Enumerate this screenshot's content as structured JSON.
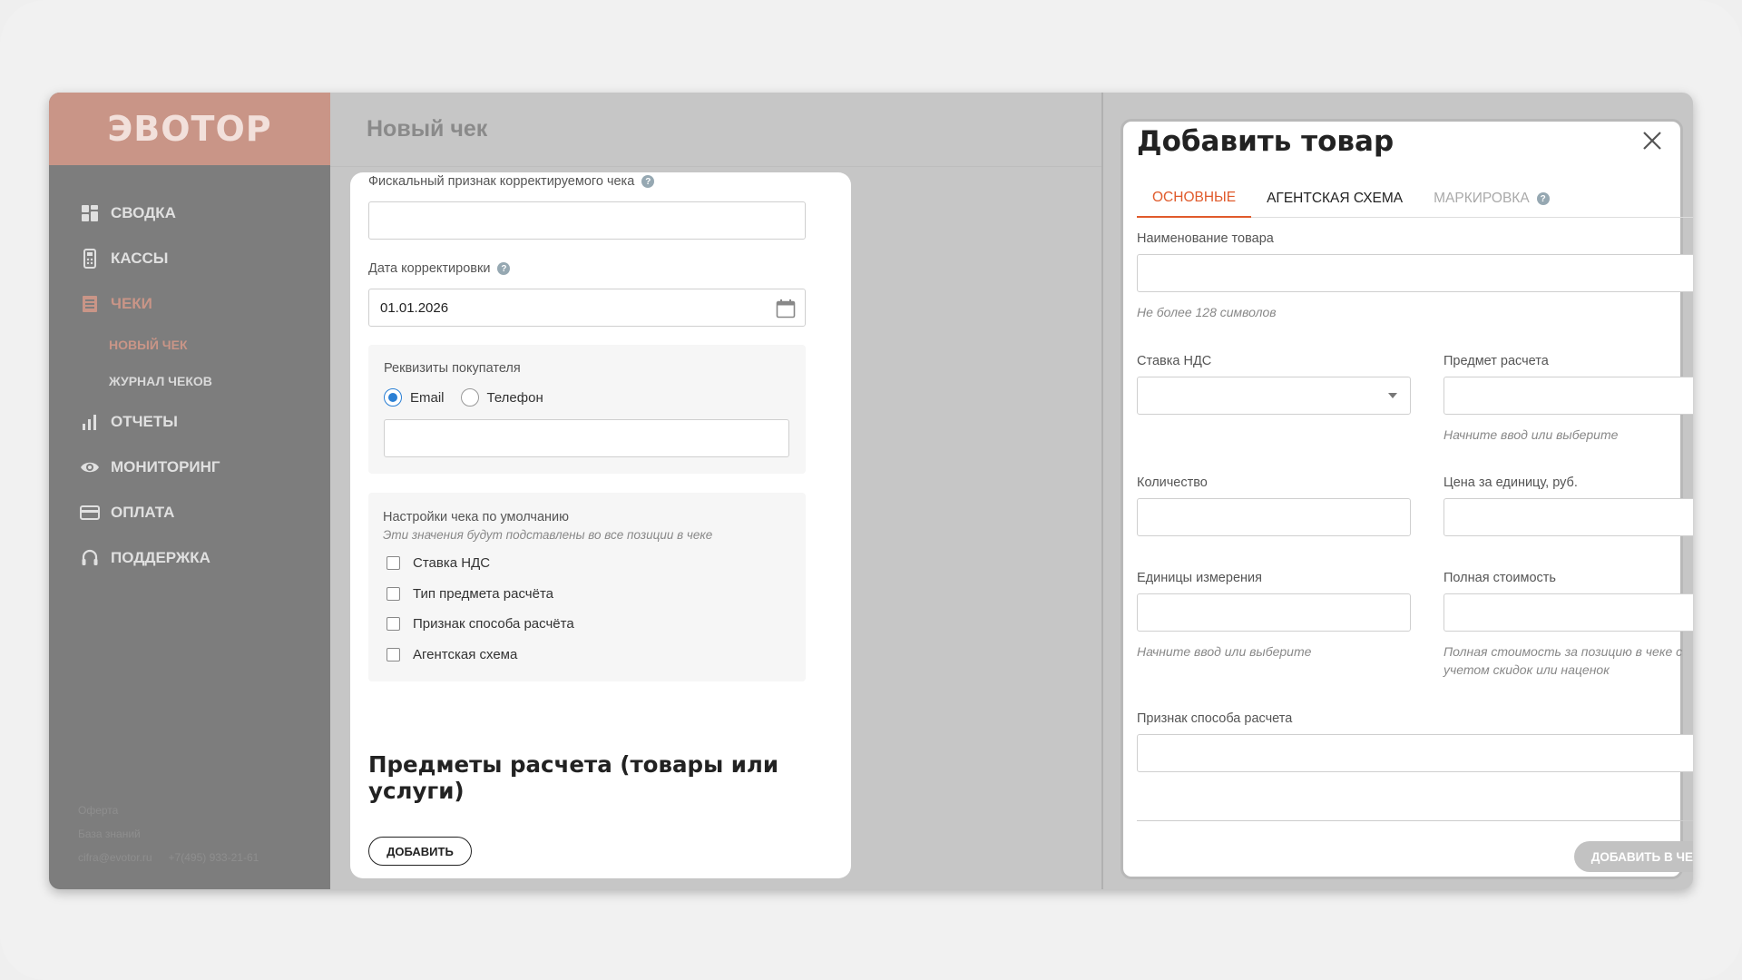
{
  "sidebar": {
    "logo": "ЭВОТОР",
    "items": [
      {
        "label": "СВОДКА",
        "icon": "dashboard-icon"
      },
      {
        "label": "КАССЫ",
        "icon": "cash-register-icon"
      },
      {
        "label": "ЧЕКИ",
        "icon": "receipt-icon"
      },
      {
        "label": "ОТЧЕТЫ",
        "icon": "bar-chart-icon"
      },
      {
        "label": "МОНИТОРИНГ",
        "icon": "eye-icon"
      },
      {
        "label": "ОПЛАТА",
        "icon": "credit-card-icon"
      },
      {
        "label": "ПОДДЕРЖКА",
        "icon": "headset-icon"
      }
    ],
    "subitems": [
      {
        "label": "НОВЫЙ ЧЕК"
      },
      {
        "label": "ЖУРНАЛ ЧЕКОВ"
      }
    ],
    "footer": {
      "offer": "Оферта",
      "knowledge": "База знаний",
      "email": "cifra@evotor.ru",
      "phone": "+7(495) 933-21-61"
    }
  },
  "main": {
    "title": "Новый чек",
    "fiscal_label": "Фискальный признак корректируемого чека",
    "fiscal_value": "",
    "date_label": "Дата корректировки",
    "date_value": "01.01.2026",
    "buyer": {
      "label": "Реквизиты покупателя",
      "options": [
        "Email",
        "Телефон"
      ],
      "selected": "Email",
      "value": ""
    },
    "defaults": {
      "label": "Настройки чека по умолчанию",
      "hint": "Эти значения будут подставлены во все позиции в чеке",
      "checkboxes": [
        "Ставка НДС",
        "Тип предмета расчёта",
        "Признак способа расчёта",
        "Агентская схема"
      ]
    },
    "section_title": "Предметы расчета (товары или услуги)",
    "add_button": "ДОБАВИТЬ"
  },
  "modal": {
    "title": "Добавить товар",
    "tabs": [
      "ОСНОВНЫЕ",
      "АГЕНТСКАЯ СХЕМА",
      "МАРКИРОВКА"
    ],
    "active_tab": "ОСНОВНЫЕ",
    "name_label": "Наименование товара",
    "name_hint": "Не более 128 символов",
    "vat_label": "Ставка НДС",
    "subject_label": "Предмет расчета",
    "subject_hint": "Начните ввод или выберите",
    "qty_label": "Количество",
    "price_label": "Цена за единицу, руб.",
    "unit_label": "Единицы измерения",
    "unit_hint": "Начните ввод или выберите",
    "total_label": "Полная стоимость",
    "total_hint": "Полная стоимость за позицию в чеке с учетом скидок или наценок",
    "method_label": "Признак способа расчета",
    "submit_label": "ДОБАВИТЬ В ЧЕК"
  },
  "colors": {
    "accent": "#e05a2b",
    "logo_bar": "#c99587",
    "sidebar": "#7d7d7d",
    "radio_blue": "#2a7fd4"
  }
}
